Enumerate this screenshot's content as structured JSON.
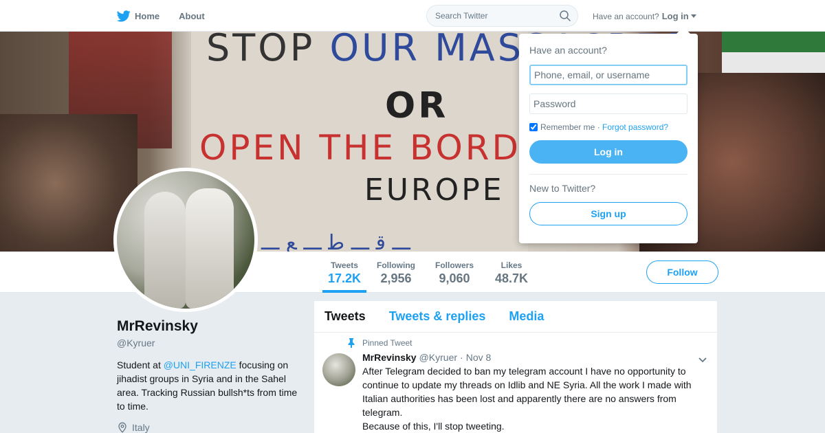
{
  "colors": {
    "accent": "#1da1f2",
    "login_button": "#4ab3f4",
    "background": "#e6ecf0"
  },
  "nav": {
    "home_label": "Home",
    "about_label": "About",
    "search_placeholder": "Search Twitter",
    "have_account": "Have an account?",
    "login_label": "Log in"
  },
  "banner": {
    "sign_line1_a": "STOP ",
    "sign_line1_b": "OUR MASSACRES",
    "sign_line2": "OR",
    "sign_line3": "OPEN THE BORDERS",
    "sign_line4": "EUROPE"
  },
  "stats": [
    {
      "label": "Tweets",
      "value": "17.2K"
    },
    {
      "label": "Following",
      "value": "2,956"
    },
    {
      "label": "Followers",
      "value": "9,060"
    },
    {
      "label": "Likes",
      "value": "48.7K"
    }
  ],
  "follow_label": "Follow",
  "profile": {
    "name": "MrRevinsky",
    "handle": "@Kyruer",
    "bio_prefix": "Student at ",
    "bio_link": "@UNI_FIRENZE",
    "bio_suffix": " focusing on jihadist groups in Syria and in the Sahel area. Tracking Russian bullsh*ts from time to time.",
    "location": "Italy"
  },
  "timeline": {
    "tabs": [
      "Tweets",
      "Tweets & replies",
      "Media"
    ],
    "pinned_label": "Pinned Tweet",
    "tweet": {
      "name": "MrRevinsky",
      "handle": "@Kyruer",
      "separator": "·",
      "time": "Nov 8",
      "text_line1": "After Telegram decided to ban my telegram account I have no opportunity to continue to update my threads on Idlib and NE Syria. All the work I made with Italian authorities has been lost and apparently there are no answers from telegram.",
      "text_line2": "Because of this, I'll stop tweeting."
    }
  },
  "login_dropdown": {
    "title": "Have an account?",
    "username_placeholder": "Phone, email, or username",
    "password_placeholder": "Password",
    "remember_label": "Remember me",
    "separator": " · ",
    "forgot_label": "Forgot password?",
    "login_button": "Log in",
    "new_label": "New to Twitter?",
    "signup_button": "Sign up"
  }
}
